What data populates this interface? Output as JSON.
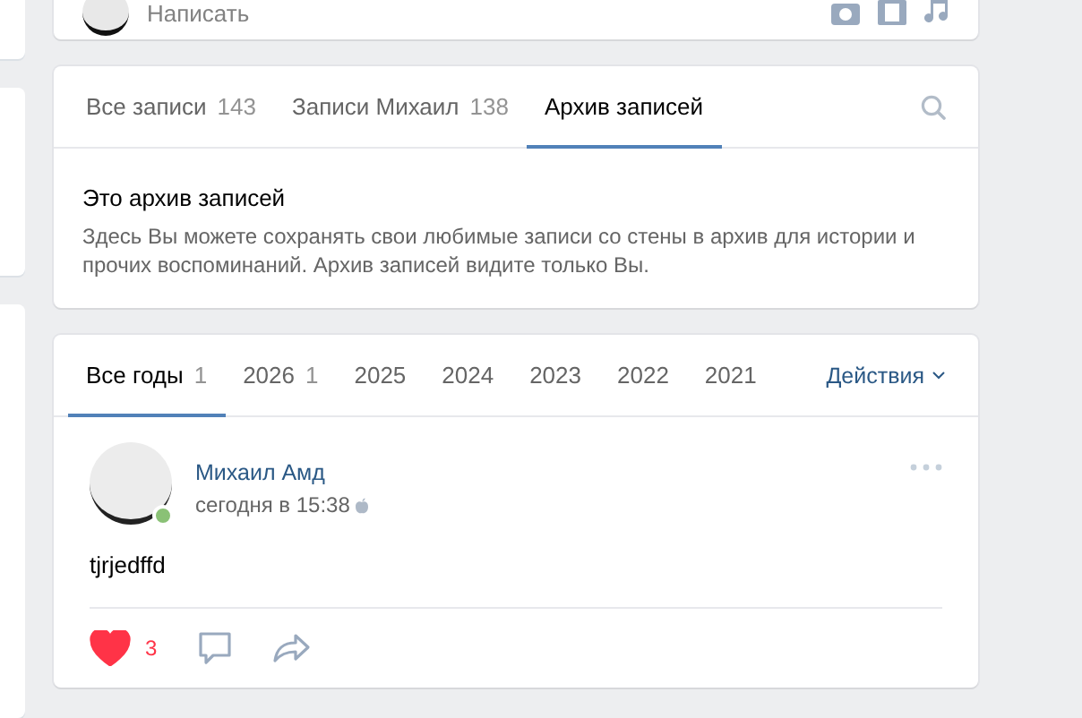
{
  "composer": {
    "placeholder": "Написать"
  },
  "wall_tabs": [
    {
      "label": "Все записи",
      "count": "143",
      "selected": false
    },
    {
      "label": "Записи Михаил",
      "count": "138",
      "selected": false
    },
    {
      "label": "Архив записей",
      "selected": true
    }
  ],
  "archive_info": {
    "title": "Это архив записей",
    "text": "Здесь Вы можете сохранять свои любимые записи со стены в архив для истории и прочих воспоминаний. Архив записей видите только Вы."
  },
  "year_tabs": [
    {
      "label": "Все годы",
      "count": "1",
      "selected": true
    },
    {
      "label": "2026",
      "count": "1",
      "selected": false
    },
    {
      "label": "2025",
      "selected": false
    },
    {
      "label": "2024",
      "selected": false
    },
    {
      "label": "2023",
      "selected": false
    },
    {
      "label": "2022",
      "selected": false
    },
    {
      "label": "2021",
      "selected": false
    }
  ],
  "actions_label": "Действия",
  "post": {
    "author": "Михаил Амд",
    "time": "сегодня в 15:38",
    "online": true,
    "text": "tjrjedffd",
    "liked": true,
    "likes": "3"
  }
}
